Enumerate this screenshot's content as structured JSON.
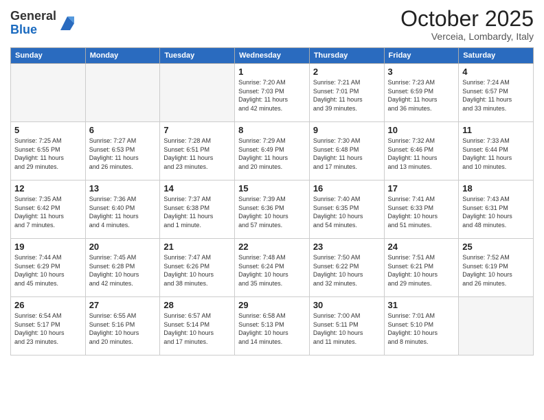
{
  "header": {
    "logo_general": "General",
    "logo_blue": "Blue",
    "month": "October 2025",
    "location": "Verceia, Lombardy, Italy"
  },
  "weekdays": [
    "Sunday",
    "Monday",
    "Tuesday",
    "Wednesday",
    "Thursday",
    "Friday",
    "Saturday"
  ],
  "weeks": [
    [
      {
        "day": "",
        "info": ""
      },
      {
        "day": "",
        "info": ""
      },
      {
        "day": "",
        "info": ""
      },
      {
        "day": "1",
        "info": "Sunrise: 7:20 AM\nSunset: 7:03 PM\nDaylight: 11 hours\nand 42 minutes."
      },
      {
        "day": "2",
        "info": "Sunrise: 7:21 AM\nSunset: 7:01 PM\nDaylight: 11 hours\nand 39 minutes."
      },
      {
        "day": "3",
        "info": "Sunrise: 7:23 AM\nSunset: 6:59 PM\nDaylight: 11 hours\nand 36 minutes."
      },
      {
        "day": "4",
        "info": "Sunrise: 7:24 AM\nSunset: 6:57 PM\nDaylight: 11 hours\nand 33 minutes."
      }
    ],
    [
      {
        "day": "5",
        "info": "Sunrise: 7:25 AM\nSunset: 6:55 PM\nDaylight: 11 hours\nand 29 minutes."
      },
      {
        "day": "6",
        "info": "Sunrise: 7:27 AM\nSunset: 6:53 PM\nDaylight: 11 hours\nand 26 minutes."
      },
      {
        "day": "7",
        "info": "Sunrise: 7:28 AM\nSunset: 6:51 PM\nDaylight: 11 hours\nand 23 minutes."
      },
      {
        "day": "8",
        "info": "Sunrise: 7:29 AM\nSunset: 6:49 PM\nDaylight: 11 hours\nand 20 minutes."
      },
      {
        "day": "9",
        "info": "Sunrise: 7:30 AM\nSunset: 6:48 PM\nDaylight: 11 hours\nand 17 minutes."
      },
      {
        "day": "10",
        "info": "Sunrise: 7:32 AM\nSunset: 6:46 PM\nDaylight: 11 hours\nand 13 minutes."
      },
      {
        "day": "11",
        "info": "Sunrise: 7:33 AM\nSunset: 6:44 PM\nDaylight: 11 hours\nand 10 minutes."
      }
    ],
    [
      {
        "day": "12",
        "info": "Sunrise: 7:35 AM\nSunset: 6:42 PM\nDaylight: 11 hours\nand 7 minutes."
      },
      {
        "day": "13",
        "info": "Sunrise: 7:36 AM\nSunset: 6:40 PM\nDaylight: 11 hours\nand 4 minutes."
      },
      {
        "day": "14",
        "info": "Sunrise: 7:37 AM\nSunset: 6:38 PM\nDaylight: 11 hours\nand 1 minute."
      },
      {
        "day": "15",
        "info": "Sunrise: 7:39 AM\nSunset: 6:36 PM\nDaylight: 10 hours\nand 57 minutes."
      },
      {
        "day": "16",
        "info": "Sunrise: 7:40 AM\nSunset: 6:35 PM\nDaylight: 10 hours\nand 54 minutes."
      },
      {
        "day": "17",
        "info": "Sunrise: 7:41 AM\nSunset: 6:33 PM\nDaylight: 10 hours\nand 51 minutes."
      },
      {
        "day": "18",
        "info": "Sunrise: 7:43 AM\nSunset: 6:31 PM\nDaylight: 10 hours\nand 48 minutes."
      }
    ],
    [
      {
        "day": "19",
        "info": "Sunrise: 7:44 AM\nSunset: 6:29 PM\nDaylight: 10 hours\nand 45 minutes."
      },
      {
        "day": "20",
        "info": "Sunrise: 7:45 AM\nSunset: 6:28 PM\nDaylight: 10 hours\nand 42 minutes."
      },
      {
        "day": "21",
        "info": "Sunrise: 7:47 AM\nSunset: 6:26 PM\nDaylight: 10 hours\nand 38 minutes."
      },
      {
        "day": "22",
        "info": "Sunrise: 7:48 AM\nSunset: 6:24 PM\nDaylight: 10 hours\nand 35 minutes."
      },
      {
        "day": "23",
        "info": "Sunrise: 7:50 AM\nSunset: 6:22 PM\nDaylight: 10 hours\nand 32 minutes."
      },
      {
        "day": "24",
        "info": "Sunrise: 7:51 AM\nSunset: 6:21 PM\nDaylight: 10 hours\nand 29 minutes."
      },
      {
        "day": "25",
        "info": "Sunrise: 7:52 AM\nSunset: 6:19 PM\nDaylight: 10 hours\nand 26 minutes."
      }
    ],
    [
      {
        "day": "26",
        "info": "Sunrise: 6:54 AM\nSunset: 5:17 PM\nDaylight: 10 hours\nand 23 minutes."
      },
      {
        "day": "27",
        "info": "Sunrise: 6:55 AM\nSunset: 5:16 PM\nDaylight: 10 hours\nand 20 minutes."
      },
      {
        "day": "28",
        "info": "Sunrise: 6:57 AM\nSunset: 5:14 PM\nDaylight: 10 hours\nand 17 minutes."
      },
      {
        "day": "29",
        "info": "Sunrise: 6:58 AM\nSunset: 5:13 PM\nDaylight: 10 hours\nand 14 minutes."
      },
      {
        "day": "30",
        "info": "Sunrise: 7:00 AM\nSunset: 5:11 PM\nDaylight: 10 hours\nand 11 minutes."
      },
      {
        "day": "31",
        "info": "Sunrise: 7:01 AM\nSunset: 5:10 PM\nDaylight: 10 hours\nand 8 minutes."
      },
      {
        "day": "",
        "info": ""
      }
    ]
  ]
}
